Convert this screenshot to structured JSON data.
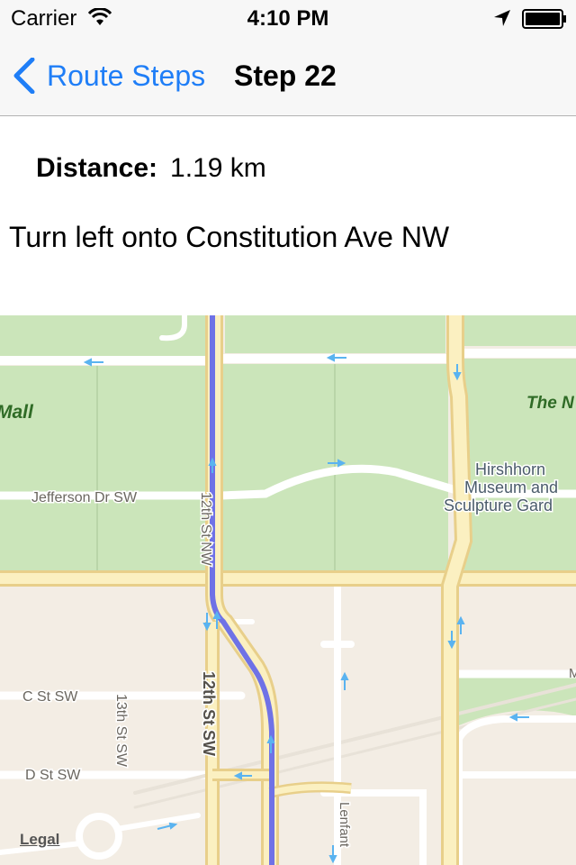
{
  "status_bar": {
    "carrier": "Carrier",
    "time": "4:10 PM"
  },
  "nav": {
    "back_label": "Route Steps",
    "title": "Step 22"
  },
  "step": {
    "distance_label": "Distance:",
    "distance_value": "1.19 km",
    "instruction": "Turn left onto Constitution Ave NW"
  },
  "map": {
    "labels": {
      "mall": "Mall",
      "the_n": "The N",
      "jefferson": "Jefferson Dr SW",
      "twelfth_nw": "12th St NW",
      "twelfth_sw": "12th St SW",
      "thirteenth_sw": "13th St SW",
      "c_st": "C St SW",
      "d_st": "D St SW",
      "lenfant": "Lenfant",
      "hirsh1": "Hirshhorn",
      "hirsh2": "Museum and",
      "hirsh3": "Sculpture Gard",
      "m_edge": "M"
    },
    "legal": "Legal"
  }
}
